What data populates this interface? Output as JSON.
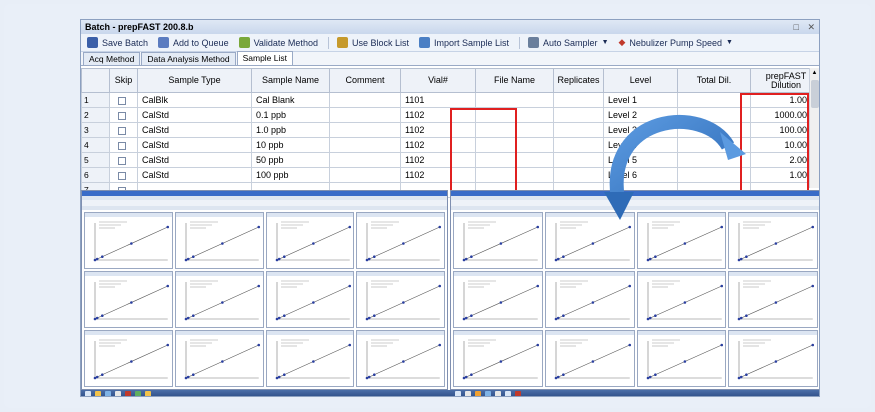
{
  "window": {
    "title": "Batch - prepFAST 200.8.b",
    "controls": [
      "□",
      "✕"
    ]
  },
  "toolbar": {
    "items": [
      {
        "label": "Save Batch",
        "icon": "save-icon",
        "color": "#3b5fa8"
      },
      {
        "label": "Add to Queue",
        "icon": "add-to-queue-icon",
        "color": "#5b7cc0"
      },
      {
        "label": "Validate Method",
        "icon": "validate-icon",
        "color": "#7aa83a"
      },
      {
        "label": "Use Block List",
        "icon": "block-list-icon",
        "color": "#c69a2c"
      },
      {
        "label": "Import Sample List",
        "icon": "import-icon",
        "color": "#4b7fc4"
      },
      {
        "label": "Auto Sampler",
        "icon": "autosampler-icon",
        "color": "#6a7f9c"
      },
      {
        "label": "Nebulizer Pump Speed",
        "icon": "pump-speed-icon",
        "color": "#c0392b"
      }
    ]
  },
  "tabs": [
    "Acq Method",
    "Data Analysis Method",
    "Sample List"
  ],
  "table": {
    "columns": [
      "",
      "Skip",
      "Sample Type",
      "Sample Name",
      "Comment",
      "Vial#",
      "File Name",
      "Replicates",
      "Level",
      "Total Dil.",
      "prepFAST\nDilution"
    ],
    "rows": [
      {
        "n": "1",
        "type": "CalBlk",
        "name": "Cal Blank",
        "vial": "1101",
        "level": "Level 1",
        "dil": "1.0000"
      },
      {
        "n": "2",
        "type": "CalStd",
        "name": "0.1 ppb",
        "vial": "1102",
        "level": "Level 2",
        "dil": "1000.0000"
      },
      {
        "n": "3",
        "type": "CalStd",
        "name": "1.0 ppb",
        "vial": "1102",
        "level": "Level 3",
        "dil": "100.0000"
      },
      {
        "n": "4",
        "type": "CalStd",
        "name": "10 ppb",
        "vial": "1102",
        "level": "Level 4",
        "dil": "10.0000"
      },
      {
        "n": "5",
        "type": "CalStd",
        "name": "50 ppb",
        "vial": "1102",
        "level": "Level 5",
        "dil": "2.0000"
      },
      {
        "n": "6",
        "type": "CalStd",
        "name": "100 ppb",
        "vial": "1102",
        "level": "Level 6",
        "dil": "1.0000"
      },
      {
        "n": "7",
        "type": "",
        "name": "",
        "vial": "",
        "level": "",
        "dil": ""
      }
    ]
  },
  "colors": {
    "highlight": "#e02020",
    "arrow": "#3f7fc9"
  }
}
